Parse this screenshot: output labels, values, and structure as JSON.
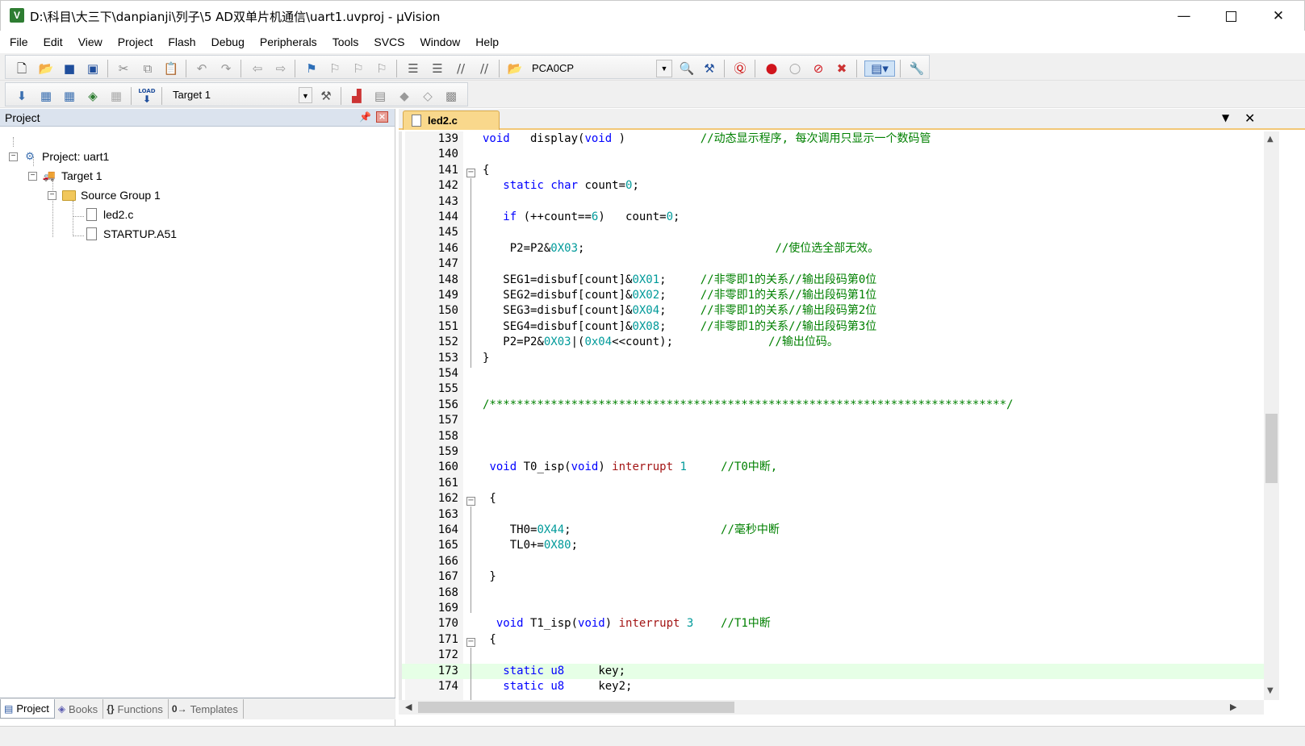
{
  "window": {
    "title": "D:\\科目\\大三下\\danpianji\\列子\\5 AD双单片机通信\\uart1.uvproj - µVision",
    "app_icon": "µVision logo",
    "minimize": "—",
    "close": "✕"
  },
  "menu": [
    "File",
    "Edit",
    "View",
    "Project",
    "Flash",
    "Debug",
    "Peripherals",
    "Tools",
    "SVCS",
    "Window",
    "Help"
  ],
  "toolbar": {
    "find_combo_value": "PCA0CP",
    "target_combo_value": "Target 1",
    "load_label": "LOAD"
  },
  "project_panel": {
    "title": "Project",
    "tree": {
      "project": "Project: uart1",
      "target": "Target 1",
      "group": "Source Group 1",
      "files": [
        "led2.c",
        "STARTUP.A51"
      ]
    },
    "tabs": [
      {
        "label": "Project",
        "icon": "project-icon"
      },
      {
        "label": "Books",
        "icon": "books-icon"
      },
      {
        "label": "Functions",
        "icon": "functions-icon"
      },
      {
        "label": "Templates",
        "icon": "templates-icon"
      }
    ]
  },
  "editor": {
    "tab_label": "led2.c",
    "highlighted_line": 173,
    "lines": [
      {
        "n": "139",
        "code": "void   display(void )           //动态显示程序, 每次调用只显示一个数码管"
      },
      {
        "n": "140",
        "code": ""
      },
      {
        "n": "141",
        "code": "{"
      },
      {
        "n": "142",
        "code": "   static char count=0;"
      },
      {
        "n": "143",
        "code": ""
      },
      {
        "n": "144",
        "code": "   if (++count==6)   count=0;"
      },
      {
        "n": "145",
        "code": ""
      },
      {
        "n": "146",
        "code": "    P2=P2&0X03;                            //使位选全部无效。"
      },
      {
        "n": "147",
        "code": ""
      },
      {
        "n": "148",
        "code": "   SEG1=disbuf[count]&0X01;     //非零即1的关系//输出段码第0位"
      },
      {
        "n": "149",
        "code": "   SEG2=disbuf[count]&0X02;     //非零即1的关系//输出段码第1位"
      },
      {
        "n": "150",
        "code": "   SEG3=disbuf[count]&0X04;     //非零即1的关系//输出段码第2位"
      },
      {
        "n": "151",
        "code": "   SEG4=disbuf[count]&0X08;     //非零即1的关系//输出段码第3位"
      },
      {
        "n": "152",
        "code": "   P2=P2&0X03|(0x04<<count);              //输出位码。"
      },
      {
        "n": "153",
        "code": "}"
      },
      {
        "n": "154",
        "code": ""
      },
      {
        "n": "155",
        "code": ""
      },
      {
        "n": "156",
        "code": "/****************************************************************************/"
      },
      {
        "n": "157",
        "code": ""
      },
      {
        "n": "158",
        "code": ""
      },
      {
        "n": "159",
        "code": ""
      },
      {
        "n": "160",
        "code": " void T0_isp(void) interrupt 1     //T0中断,"
      },
      {
        "n": "161",
        "code": ""
      },
      {
        "n": "162",
        "code": " {"
      },
      {
        "n": "163",
        "code": ""
      },
      {
        "n": "164",
        "code": "    TH0=0X44;                      //毫秒中断"
      },
      {
        "n": "165",
        "code": "    TL0+=0X80;"
      },
      {
        "n": "166",
        "code": ""
      },
      {
        "n": "167",
        "code": " }"
      },
      {
        "n": "168",
        "code": ""
      },
      {
        "n": "169",
        "code": ""
      },
      {
        "n": "170",
        "code": "  void T1_isp(void) interrupt 3    //T1中断"
      },
      {
        "n": "171",
        "code": " {"
      },
      {
        "n": "172",
        "code": ""
      },
      {
        "n": "173",
        "code": "   static u8     key;"
      },
      {
        "n": "174",
        "code": "   static u8     key2;"
      }
    ]
  },
  "colors": {
    "keyword": "#0000ff",
    "number": "#009a9a",
    "comment": "#008000",
    "interrupt": "#a31515",
    "active_tab": "#f9d88c",
    "current_line": "#e6ffe6"
  }
}
